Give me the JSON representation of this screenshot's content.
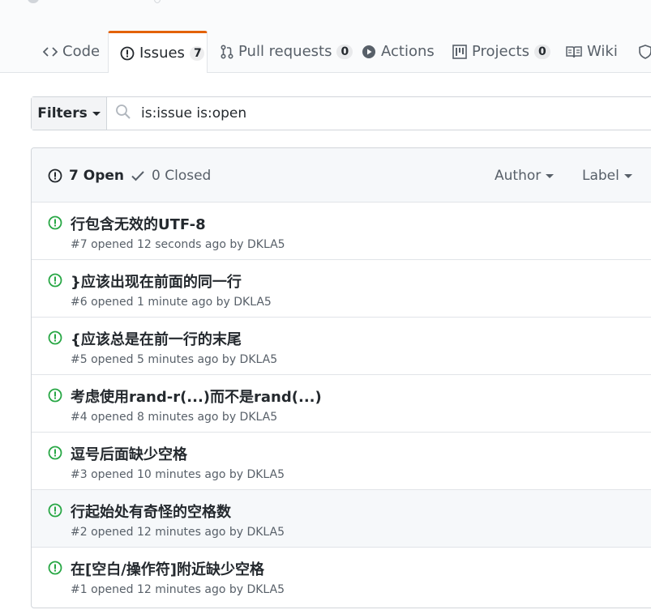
{
  "tabs": [
    {
      "label": "Code",
      "icon": "code-icon"
    },
    {
      "label": "Issues",
      "icon": "issue-opened-icon",
      "count": "7"
    },
    {
      "label": "Pull requests",
      "icon": "git-pull-request-icon",
      "count": "0"
    },
    {
      "label": "Actions",
      "icon": "play-icon"
    },
    {
      "label": "Projects",
      "icon": "project-icon",
      "count": "0"
    },
    {
      "label": "Wiki",
      "icon": "book-icon"
    }
  ],
  "filter_bar": {
    "filters_label": "Filters",
    "search_value": "is:issue is:open"
  },
  "issues_header": {
    "open_label": "7 Open",
    "closed_label": "0 Closed",
    "author_label": "Author",
    "label_label": "Label"
  },
  "issues": [
    {
      "title": "行包含无效的UTF-8",
      "meta": "#7 opened 12 seconds ago by DKLA5"
    },
    {
      "title": "}应该出现在前面的同一行",
      "meta": "#6 opened 1 minute ago by DKLA5"
    },
    {
      "title": "{应该总是在前一行的末尾",
      "meta": "#5 opened 5 minutes ago by DKLA5"
    },
    {
      "title": "考虑使用rand-r(...)而不是rand(...)",
      "meta": "#4 opened 8 minutes ago by DKLA5"
    },
    {
      "title": "逗号后面缺少空格",
      "meta": "#3 opened 10 minutes ago by DKLA5"
    },
    {
      "title": "行起始处有奇怪的空格数",
      "meta": "#2 opened 12 minutes ago by DKLA5"
    },
    {
      "title": "在[空白/操作符]附近缺少空格",
      "meta": "#1 opened 12 minutes ago by DKLA5"
    }
  ],
  "colors": {
    "accent_tab": "#e36209",
    "open_issue": "#28a745",
    "text_primary": "#24292e",
    "text_muted": "#586069"
  }
}
